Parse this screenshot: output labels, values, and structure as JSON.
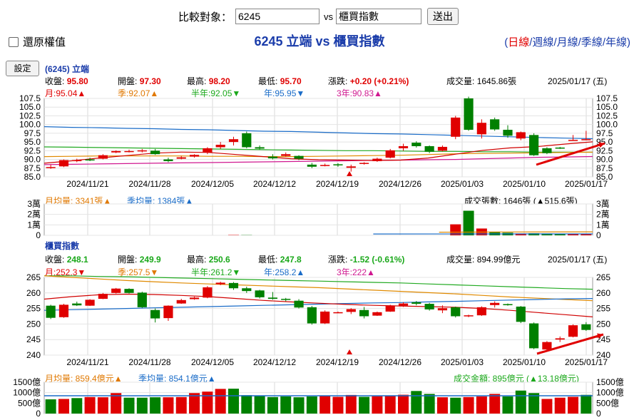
{
  "compare": {
    "label": "比較對象：",
    "code_value": "6245",
    "vs": "vs",
    "index_value": "櫃買指數",
    "send": "送出"
  },
  "restore_label": "還原權值",
  "page_title": "6245 立端 vs 櫃買指數",
  "periods": {
    "open": "(",
    "close": ")",
    "sep": "/",
    "items": [
      "日線",
      "週線",
      "月線",
      "季線",
      "年線"
    ],
    "selected": 0
  },
  "settings_button": "設定",
  "stock": {
    "name": "(6245) 立端",
    "close_label": "收盤:",
    "close": "95.80",
    "open_label": "開盤:",
    "open": "97.30",
    "high_label": "最高:",
    "high": "98.20",
    "low_label": "最低:",
    "low": "95.70",
    "change_label": "漲跌:",
    "change": "+0.20",
    "change_pct": "(+0.21%)",
    "volume_label": "成交量:",
    "volume": "1645.86張",
    "date": "2025/01/17 (五)",
    "ma_month": "月:95.04",
    "ma_month_arrow": "▲",
    "ma_quarter": "季:92.07",
    "ma_quarter_arrow": "▲",
    "ma_half": "半年:92.05",
    "ma_half_arrow": "▼",
    "ma_year": "年:95.95",
    "ma_year_arrow": "▼",
    "ma_3y": "3年:90.83",
    "ma_3y_arrow": "▲",
    "vol_month": "月均量: 3341張",
    "vol_month_arrow": "▲",
    "vol_quarter": "季均量: 1384張",
    "vol_quarter_arrow": "▲",
    "vol_summary": "成交張數: 1646張 (▲515.6張)"
  },
  "index": {
    "name": "櫃買指數",
    "close_label": "收盤:",
    "close": "248.1",
    "open_label": "開盤:",
    "open": "249.9",
    "high_label": "最高:",
    "high": "250.6",
    "low_label": "最低:",
    "low": "247.8",
    "change_label": "漲跌:",
    "change": "-1.52",
    "change_pct": "(-0.61%)",
    "volume_label": "成交量:",
    "volume": "894.99億元",
    "date": "2025/01/17 (五)",
    "ma_month": "月:252.3",
    "ma_month_arrow": "▼",
    "ma_quarter": "季:257.5",
    "ma_quarter_arrow": "▼",
    "ma_half": "半年:261.2",
    "ma_half_arrow": "▼",
    "ma_year": "年:258.2",
    "ma_year_arrow": "▲",
    "ma_3y": "3年:222",
    "ma_3y_arrow": "▲",
    "vol_month": "月均量: 859.4億元",
    "vol_month_arrow": "▲",
    "vol_quarter": "季均量: 854.1億元",
    "vol_quarter_arrow": "▲",
    "vol_summary": "成交金額: 895億元 (▲13.18億元)"
  },
  "colors": {
    "up": "#e00000",
    "down": "#008000",
    "ma_month": "#d00000",
    "ma_quarter": "#e08a00",
    "ma_half": "#22aa22",
    "ma_year": "#1a6cc8",
    "ma_3y": "#d01890",
    "annotation": "#e00000"
  },
  "chart_data": [
    {
      "type": "candlestick",
      "x_tick_labels": [
        "2024/11/21",
        "2024/11/28",
        "2024/12/05",
        "2024/12/12",
        "2024/12/19",
        "2024/12/26",
        "2025/01/03",
        "2025/01/10",
        "2025/01/17"
      ],
      "y_ticks": [
        "107.5",
        "105.0",
        "102.5",
        "100.0",
        "97.5",
        "95.0",
        "92.5",
        "90.0",
        "87.5",
        "85.0"
      ],
      "ylim": [
        85,
        107.5
      ],
      "candles": [
        [
          87.5,
          88.5,
          87.3,
          87.8
        ],
        [
          88,
          90,
          87.8,
          89.8
        ],
        [
          89.5,
          90.2,
          89.2,
          89.8
        ],
        [
          90,
          90.5,
          89.5,
          89.8
        ],
        [
          90.2,
          91.5,
          90,
          91.2
        ],
        [
          92,
          92.6,
          91.8,
          92.4
        ],
        [
          92.4,
          92.8,
          92,
          92.4
        ],
        [
          92.5,
          93,
          92,
          92.6
        ],
        [
          92.5,
          93,
          91.3,
          91.5
        ],
        [
          90,
          90.5,
          89.2,
          89.5
        ],
        [
          90.2,
          91,
          90,
          90.6
        ],
        [
          90.8,
          91.5,
          90.5,
          91.3
        ],
        [
          92,
          93.5,
          91.5,
          93.2
        ],
        [
          93.5,
          95,
          93,
          94.2
        ],
        [
          95,
          96.5,
          94,
          95.8
        ],
        [
          97.5,
          98,
          93.2,
          93.5
        ],
        [
          93.5,
          94,
          92.8,
          93.1
        ],
        [
          90.8,
          91.5,
          90,
          90.3
        ],
        [
          91,
          92,
          90.8,
          91.5
        ],
        [
          91,
          91.2,
          89.8,
          90.2
        ],
        [
          88.5,
          89,
          87.5,
          87.9
        ],
        [
          88.3,
          88.8,
          88,
          88.4
        ],
        [
          88.6,
          88.9,
          87.9,
          88.3
        ],
        [
          87.6,
          88.5,
          86.5,
          88
        ],
        [
          88.8,
          89.2,
          88.5,
          89
        ],
        [
          89.5,
          90.5,
          89.3,
          90.2
        ],
        [
          90.5,
          93,
          90.3,
          92.6
        ],
        [
          93.2,
          94.5,
          92.5,
          93.8
        ],
        [
          94.8,
          95.2,
          93.4,
          93.8
        ],
        [
          93.8,
          94,
          91.8,
          92.2
        ],
        [
          92.5,
          94,
          92.3,
          93.6
        ],
        [
          96.5,
          102.5,
          95.8,
          102
        ],
        [
          107.5,
          108,
          98.2,
          98.5
        ],
        [
          97.2,
          101.5,
          96,
          100.5
        ],
        [
          101.5,
          102,
          98.2,
          98.6
        ],
        [
          98.5,
          99.8,
          96.2,
          96.8
        ],
        [
          96,
          98,
          95.5,
          97.8
        ],
        [
          97,
          97.5,
          91,
          91.2
        ],
        [
          93.2,
          93.5,
          91.5,
          91.8
        ],
        [
          93.4,
          93.6,
          93,
          93.2
        ],
        [
          95.6,
          97,
          95.4,
          95.6
        ],
        [
          95.6,
          98.2,
          95.7,
          95.8
        ]
      ],
      "ma": {
        "month": [
          88.9,
          89.6,
          90.4,
          91.1,
          91.8,
          92.1,
          92,
          91.4,
          90.8,
          90.2,
          89.9,
          89.8,
          89.7,
          89.8,
          90.4,
          91.5,
          92.6,
          93.3,
          93.7,
          94.4,
          95.04
        ],
        "quarter": [
          90.8,
          90.9,
          91,
          91,
          91,
          91,
          90.9,
          90.9,
          90.8,
          90.8,
          90.9,
          91,
          91.1,
          91.2,
          91.4,
          91.6,
          91.7,
          91.8,
          91.9,
          92,
          92.07
        ],
        "half": [
          93.6,
          93.5,
          93.4,
          93.3,
          93.2,
          93.1,
          93,
          92.9,
          92.8,
          92.7,
          92.6,
          92.5,
          92.5,
          92.4,
          92.3,
          92.3,
          92.2,
          92.2,
          92.1,
          92.1,
          92.05
        ],
        "year": [
          99.4,
          99.2,
          99.1,
          98.9,
          98.8,
          98.6,
          98.5,
          98.3,
          98.1,
          98,
          97.8,
          97.6,
          97.4,
          97.3,
          97.1,
          96.9,
          96.7,
          96.5,
          96.3,
          96.1,
          95.95
        ],
        "three_year": [
          88.5,
          88.6,
          88.7,
          88.8,
          88.9,
          89,
          89.1,
          89.2,
          89.3,
          89.4,
          89.5,
          89.6,
          89.7,
          89.8,
          89.9,
          90,
          90.2,
          90.4,
          90.6,
          90.7,
          90.83
        ]
      },
      "volume": {
        "y_ticks": [
          "3萬",
          "2萬",
          "1萬",
          "0"
        ],
        "ylim": [
          0,
          30000
        ],
        "values": [
          0,
          0,
          0,
          0,
          0,
          0,
          0,
          0,
          0,
          0,
          0,
          0,
          0,
          0,
          300,
          200,
          0,
          0,
          0,
          0,
          0,
          0,
          0,
          0,
          0,
          0,
          0,
          0,
          0,
          0,
          0,
          10500,
          23500,
          6500,
          3500,
          2500,
          1800,
          2000,
          1800,
          1300,
          1700,
          1646
        ]
      }
    },
    {
      "type": "candlestick",
      "x_tick_labels": [
        "2024/11/21",
        "2024/11/28",
        "2024/12/05",
        "2024/12/12",
        "2024/12/19",
        "2024/12/26",
        "2025/01/03",
        "2025/01/10",
        "2025/01/17"
      ],
      "y_ticks": [
        "265",
        "260",
        "255",
        "250",
        "245",
        "240"
      ],
      "ylim": [
        240,
        265
      ],
      "candles": [
        [
          255.9,
          256.2,
          251.6,
          252
        ],
        [
          252.2,
          256.5,
          252,
          256.2
        ],
        [
          256.6,
          257.2,
          255.8,
          256
        ],
        [
          255.9,
          258,
          255.8,
          257.8
        ],
        [
          258.1,
          260,
          258,
          259.7
        ],
        [
          260,
          261.6,
          259.8,
          261.4
        ],
        [
          261.3,
          261.5,
          259.8,
          260
        ],
        [
          260.1,
          260.4,
          255.2,
          255.4
        ],
        [
          254.5,
          255,
          250.5,
          251.8
        ],
        [
          251.9,
          256,
          251,
          255.9
        ],
        [
          256.6,
          258.1,
          256.5,
          257.7
        ],
        [
          258,
          258.8,
          257.8,
          258.5
        ],
        [
          258.5,
          262.2,
          258.3,
          261.8
        ],
        [
          262.8,
          263.6,
          262.5,
          263.3
        ],
        [
          263.2,
          263.5,
          261,
          261.5
        ],
        [
          261.5,
          262,
          260,
          260.6
        ],
        [
          260.8,
          261,
          258.2,
          258.6
        ],
        [
          258.5,
          260.3,
          257.8,
          258.1
        ],
        [
          258.1,
          258.4,
          257.3,
          257.8
        ],
        [
          257.5,
          258,
          255,
          255.3
        ],
        [
          255.4,
          255.8,
          249.8,
          250.2
        ],
        [
          250.2,
          254.4,
          250,
          254
        ],
        [
          253.8,
          254,
          253.5,
          253.8
        ],
        [
          253.9,
          255.1,
          253.2,
          254.8
        ],
        [
          254.5,
          255.5,
          251.8,
          252.5
        ],
        [
          252.7,
          254,
          252.6,
          253.8
        ],
        [
          254,
          256.2,
          253.9,
          255.9
        ],
        [
          255.9,
          257,
          255.5,
          256.6
        ],
        [
          257,
          257.4,
          256,
          256.5
        ],
        [
          256.5,
          256.8,
          254.3,
          254.7
        ],
        [
          254.4,
          256,
          253.5,
          255.1
        ],
        [
          255.4,
          255.6,
          252.1,
          252.5
        ],
        [
          252.6,
          253,
          252.2,
          252.8
        ],
        [
          252.8,
          255.7,
          252.6,
          255.4
        ],
        [
          256.1,
          257.3,
          255.3,
          256.8
        ],
        [
          256.4,
          256.6,
          255.9,
          256.2
        ],
        [
          255.6,
          255.8,
          250.3,
          250.7
        ],
        [
          250.2,
          250.5,
          241.9,
          242.2
        ],
        [
          241.8,
          244.5,
          241.5,
          244.2
        ],
        [
          245,
          246,
          244.2,
          245.4
        ],
        [
          245.9,
          249.9,
          245.7,
          249.6
        ],
        [
          249.9,
          250.6,
          247.8,
          248.1
        ]
      ],
      "ma": {
        "month": [
          258,
          258.8,
          259.4,
          259.6,
          259.5,
          259.2,
          258.8,
          258.2,
          257.6,
          257.1,
          256.7,
          256.3,
          256,
          255.8,
          255.6,
          255.4,
          255,
          254.4,
          253.7,
          253,
          252.3
        ],
        "quarter": [
          265.5,
          265,
          264.5,
          264,
          263.6,
          263.2,
          262.9,
          262.6,
          262.3,
          262,
          261.7,
          261.3,
          260.9,
          260.5,
          260.1,
          259.7,
          259.2,
          258.7,
          258.3,
          257.9,
          257.5
        ],
        "half": [
          265.5,
          265.5,
          265.3,
          265.2,
          265,
          264.8,
          264.6,
          264.4,
          264.2,
          264,
          263.8,
          263.6,
          263.4,
          263.2,
          262.9,
          262.6,
          262.3,
          262,
          261.7,
          261.4,
          261.2
        ],
        "year": [
          254.4,
          254.6,
          254.8,
          255,
          255.2,
          255.4,
          255.6,
          255.8,
          256,
          256.2,
          256.4,
          256.6,
          256.8,
          256.9,
          257.1,
          257.3,
          257.5,
          257.7,
          257.9,
          258.1,
          258.2
        ]
      },
      "volume": {
        "y_ticks": [
          "1500億",
          "1000億",
          "500億",
          "0"
        ],
        "ylim": [
          0,
          1500
        ],
        "values": [
          680,
          700,
          740,
          790,
          780,
          980,
          760,
          760,
          780,
          780,
          790,
          980,
          1050,
          1180,
          1190,
          880,
          860,
          790,
          820,
          780,
          820,
          860,
          800,
          890,
          800,
          830,
          860,
          900,
          1080,
          940,
          780,
          760,
          790,
          820,
          940,
          820,
          1100,
          980,
          700,
          760,
          800,
          895
        ],
        "ma_quarter_value": 854.1
      }
    }
  ]
}
